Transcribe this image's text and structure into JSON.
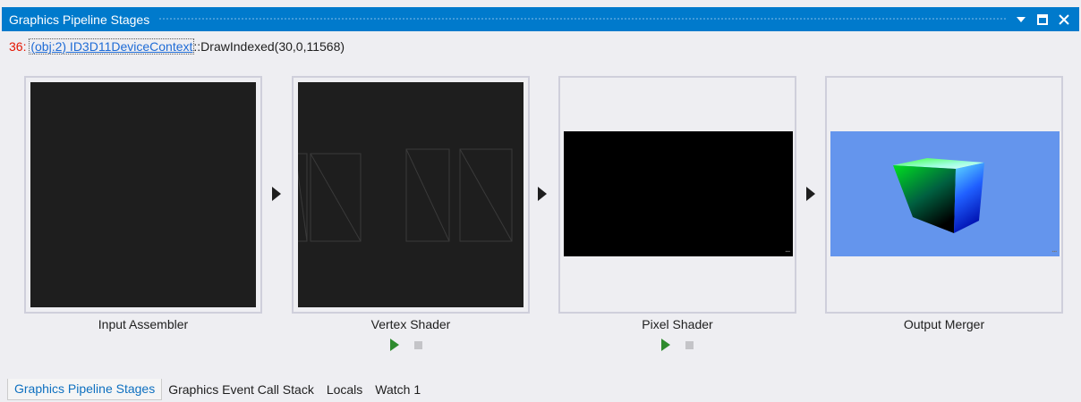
{
  "window": {
    "title": "Graphics Pipeline Stages",
    "controls": {
      "dropdown_icon": "dropdown-icon",
      "maximize_icon": "maximize-icon",
      "close_icon": "close-icon"
    }
  },
  "call": {
    "event_number": "36:",
    "object_link": "(obj:2) ID3D11DeviceContext",
    "method": "::DrawIndexed(30,0,11568)"
  },
  "stages": [
    {
      "label": "Input Assembler",
      "has_controls": false
    },
    {
      "label": "Vertex Shader",
      "has_controls": true
    },
    {
      "label": "Pixel Shader",
      "has_controls": true
    },
    {
      "label": "Output Merger",
      "has_controls": false
    }
  ],
  "colors": {
    "accent": "#007acc",
    "link": "#1e6bd6",
    "event_number": "#e51400",
    "play": "#2e8b2e",
    "render_background": "#6495ed"
  },
  "tabs": [
    {
      "label": "Graphics Pipeline Stages",
      "active": true
    },
    {
      "label": "Graphics Event Call Stack",
      "active": false
    },
    {
      "label": "Locals",
      "active": false
    },
    {
      "label": "Watch 1",
      "active": false
    }
  ]
}
